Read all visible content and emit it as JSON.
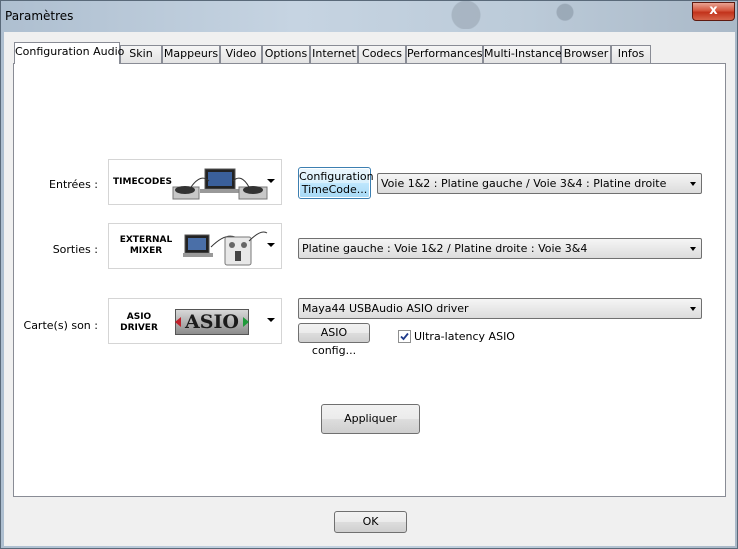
{
  "window": {
    "title": "Paramètres",
    "close_glyph": "x"
  },
  "tabs": [
    {
      "label": "Configuration Audio",
      "active": true
    },
    {
      "label": "Skin"
    },
    {
      "label": "Mappeurs"
    },
    {
      "label": "Video"
    },
    {
      "label": "Options"
    },
    {
      "label": "Internet"
    },
    {
      "label": "Codecs"
    },
    {
      "label": "Performances"
    },
    {
      "label": "Multi-Instance"
    },
    {
      "label": "Browser"
    },
    {
      "label": "Infos"
    }
  ],
  "inputs": {
    "label": "Entrées :",
    "device_text": "TIMECODES",
    "config_button": "Configuration TimeCode...",
    "routing": "Voie 1&2 : Platine gauche / Voie 3&4 : Platine droite"
  },
  "outputs": {
    "label": "Sorties :",
    "device_line1": "EXTERNAL",
    "device_line2": "MIXER",
    "routing": "Platine gauche : Voie 1&2 / Platine droite : Voie 3&4"
  },
  "soundcard": {
    "label": "Carte(s) son :",
    "device_line1": "ASIO",
    "device_line2": "DRIVER",
    "logo_text": "ASIO",
    "driver": "Maya44 USBAudio ASIO driver",
    "config_button": "ASIO config...",
    "ultra_latency_label": "Ultra-latency ASIO",
    "ultra_latency_checked": true
  },
  "apply_button": "Appliquer",
  "ok_button": "OK"
}
